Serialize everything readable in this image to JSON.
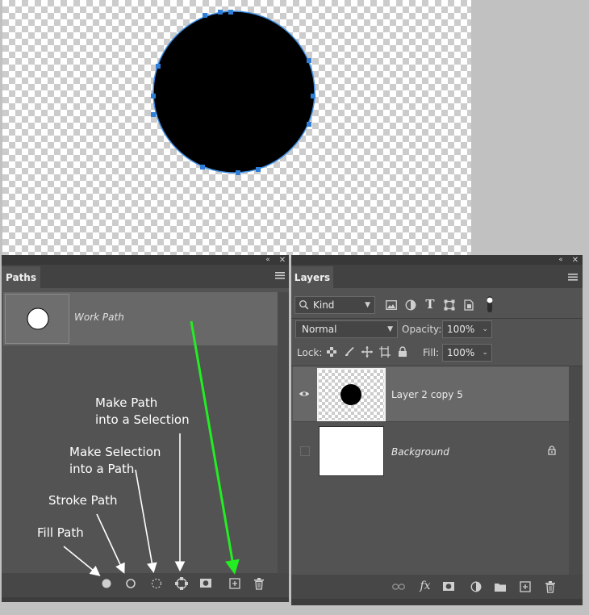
{
  "canvas": {
    "handles_count": 12
  },
  "paths_panel": {
    "tab_label": "Paths",
    "work_path_name": "Work Path",
    "footer_buttons": [
      "fill-path",
      "stroke-path",
      "load-path-as-selection",
      "make-work-path",
      "add-mask",
      "create-new-path",
      "delete-path"
    ]
  },
  "annotations": {
    "make_path_into_selection": "Make Path\ninto a Selection",
    "make_selection_into_path": "Make Selection\ninto a Path",
    "stroke_path": "Stroke Path",
    "fill_path": "Fill Path",
    "arrow_color": "#ffffff",
    "highlight_arrow_color": "#22ee22"
  },
  "layers_panel": {
    "tab_label": "Layers",
    "filter_kind": "Kind",
    "blend_mode": "Normal",
    "opacity_label": "Opacity:",
    "opacity_value": "100%",
    "lock_label": "Lock:",
    "fill_label": "Fill:",
    "fill_value": "100%",
    "layers": [
      {
        "name": "Layer 2 copy 5",
        "visible": true,
        "selected": true
      },
      {
        "name": "Background",
        "visible": false,
        "locked": true
      }
    ]
  },
  "colors": {
    "panel_bg": "#535353",
    "selected_row": "#686868",
    "path_stroke": "#3d8ee3"
  }
}
